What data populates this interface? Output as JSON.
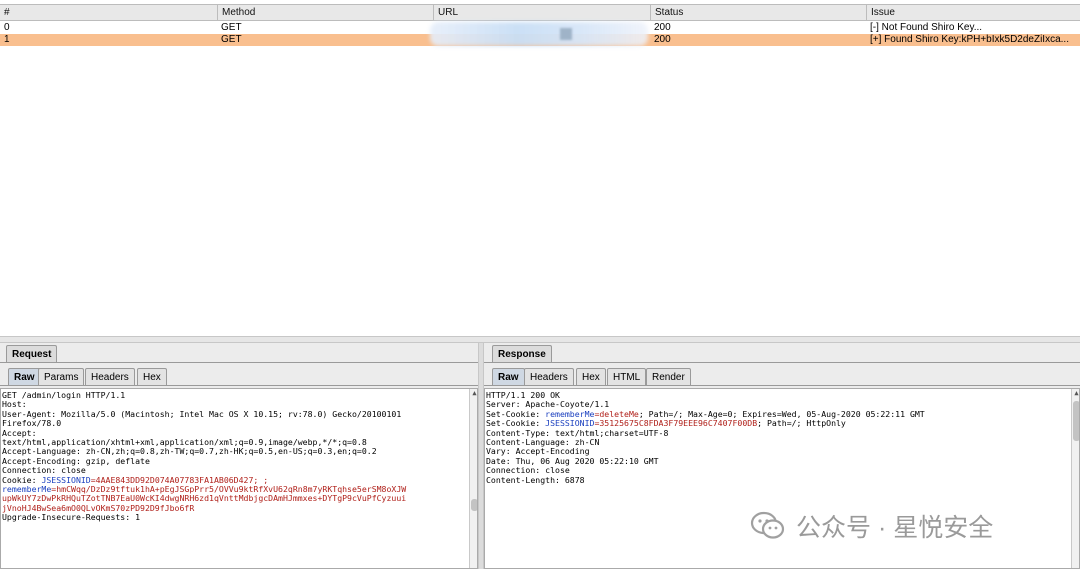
{
  "table": {
    "columns": [
      "#",
      "Method",
      "URL",
      "Status",
      "Issue"
    ],
    "rows": [
      {
        "num": "0",
        "method": "GET",
        "url": "",
        "status": "200",
        "issue": "[-] Not Found Shiro Key..."
      },
      {
        "num": "1",
        "method": "GET",
        "url": "",
        "status": "200",
        "issue": "[+] Found Shiro Key:kPH+bIxk5D2deZiIxca..."
      }
    ]
  },
  "request": {
    "title": "Request",
    "tabs": [
      "Raw",
      "Params",
      "Headers",
      "Hex"
    ],
    "lines": [
      "GET /admin/login HTTP/1.1",
      "Host:",
      "User-Agent: Mozilla/5.0 (Macintosh; Intel Mac OS X 10.15; rv:78.0) Gecko/20100101",
      "Firefox/78.0",
      "Accept:",
      "text/html,application/xhtml+xml,application/xml;q=0.9,image/webp,*/*;q=0.8",
      "Accept-Language: zh-CN,zh;q=0.8,zh-TW;q=0.7,zh-HK;q=0.5,en-US;q=0.3,en;q=0.2",
      "Accept-Encoding: gzip, deflate",
      "Connection: close"
    ],
    "cookie_prefix": "Cookie: ",
    "jsession_key": "JSESSIONID",
    "jsession_val": "=4AAE843DD92D074A07783FA1AB06D427; ;",
    "rememberme_key": "rememberMe",
    "rememberme_val_1": "=hmCWqq/DzDz9tftuk1hA+pEgJSGpPrr5/OVVu9ktRfXvU62qRn8m7yRKTqhse5erSM8oXJW",
    "rememberme_val_2": "upWkUY7zDwPkRHQuTZotTNB7EaU0WcKI4dwgNRH6zd1qVnttMdbjgcDAmHJmmxes+DYTgP9cVuPfCyzuui",
    "rememberme_val_3": "jVnoHJ4BwSea6mO0QLvOKmS70zPD92D9fJbo6fR",
    "last_line": "Upgrade-Insecure-Requests: 1"
  },
  "response": {
    "title": "Response",
    "tabs": [
      "Raw",
      "Headers",
      "Hex",
      "HTML",
      "Render"
    ],
    "status_line": "HTTP/1.1 200 OK",
    "server": "Server: Apache-Coyote/1.1",
    "setcookie1_prefix": "Set-Cookie: ",
    "setcookie1_key": "rememberMe",
    "setcookie1_val": "=deleteMe",
    "setcookie1_rest": "; Path=/; Max-Age=0; Expires=Wed, 05-Aug-2020 05:22:11 GMT",
    "setcookie2_prefix": "Set-Cookie: ",
    "setcookie2_key": "JSESSIONID",
    "setcookie2_val": "=35125675C8FDA3F79EEE96C7407F00DB",
    "setcookie2_rest": "; Path=/; HttpOnly",
    "lines": [
      "Content-Type: text/html;charset=UTF-8",
      "Content-Language: zh-CN",
      "Vary: Accept-Encoding",
      "Date: Thu, 06 Aug 2020 05:22:10 GMT",
      "Connection: close",
      "Content-Length: 6878"
    ]
  },
  "watermark": {
    "text": "公众号 · 星悦安全",
    "icon": "wechat-icon"
  }
}
